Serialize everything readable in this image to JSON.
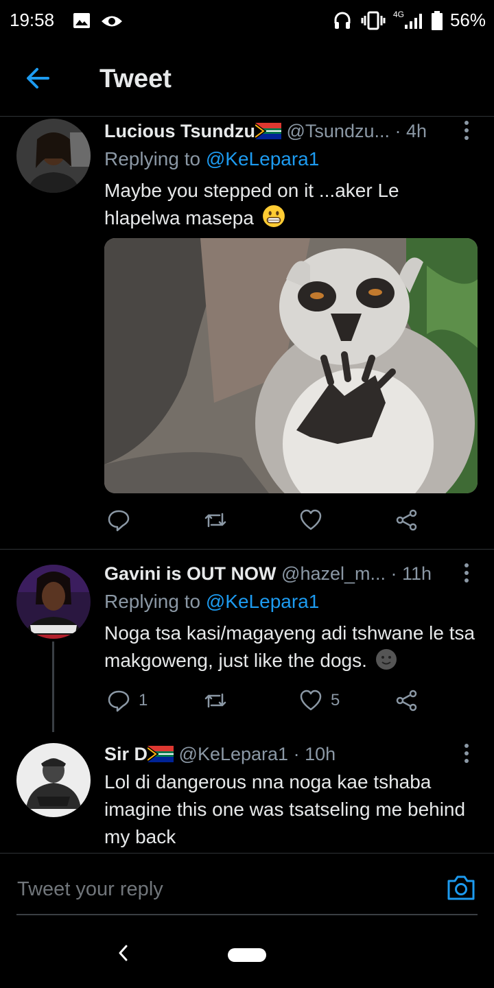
{
  "status_bar": {
    "time": "19:58",
    "network": "4G",
    "battery": "56%",
    "icons": [
      "image-icon",
      "eye-icon",
      "headphones-icon",
      "vibrate-icon",
      "signal-icon",
      "battery-icon"
    ]
  },
  "header": {
    "title": "Tweet",
    "back_icon": "arrow-left-icon"
  },
  "tweets": [
    {
      "name": "Lucious Tsundzu",
      "flag": "south-africa-flag-icon",
      "handle": "@Tsundzu...",
      "time": "· 4h",
      "replying_label": "Replying to ",
      "replying_handle": "@KeLepara1",
      "text": "Maybe you stepped on it ...aker Le hlapelwa masepa",
      "emoji": "grinning-face-emoji",
      "has_image": true,
      "image_subject": "lemur",
      "counts": {
        "reply": "",
        "retweet": "",
        "like": ""
      }
    },
    {
      "name": "Gavini is OUT NOW",
      "handle": "@hazel_m...",
      "time": "· 11h",
      "replying_label": "Replying to ",
      "replying_handle": "@KeLepara1",
      "text": "Noga tsa kasi/magayeng adi tshwane le tsa makgoweng, just like the dogs.",
      "emoji": "smiling-face-emoji",
      "counts": {
        "reply": "1",
        "retweet": "",
        "like": "5"
      }
    },
    {
      "name": "Sir D",
      "flag": "south-africa-flag-icon",
      "handle": "@KeLepara1",
      "time": "· 10h",
      "text": "Lol di dangerous nna noga kae tshaba imagine this one was tsatseling me behind my back"
    }
  ],
  "composer": {
    "placeholder": "Tweet your reply",
    "camera_icon": "camera-icon"
  },
  "colors": {
    "accent": "#1d9bf0",
    "background": "#000000",
    "muted": "#8b98a5",
    "divider": "#2f3336"
  }
}
